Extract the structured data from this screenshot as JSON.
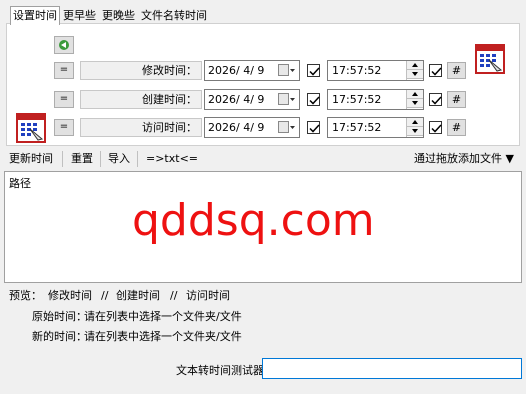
{
  "tabs": [
    {
      "label": "设置时间",
      "active": true
    },
    {
      "label": "更早些",
      "active": false
    },
    {
      "label": "更晚些",
      "active": false
    },
    {
      "label": "文件名转时间",
      "active": false
    }
  ],
  "rows": [
    {
      "equals_label": "=",
      "label": "修改时间：",
      "date": "2026/  4/  9",
      "checked": true,
      "time": "17:57:52",
      "time_checked": true,
      "hash_label": "#"
    },
    {
      "equals_label": "=",
      "label": "创建时间：",
      "date": "2026/  4/  9",
      "checked": true,
      "time": "17:57:52",
      "time_checked": true,
      "hash_label": "#"
    },
    {
      "equals_label": "=",
      "label": "访问时间：",
      "date": "2026/  4/  9",
      "checked": true,
      "time": "17:57:52",
      "time_checked": true,
      "hash_label": "#"
    }
  ],
  "toolbar": {
    "update": "更新时间",
    "reset": "重置",
    "import": "导入",
    "txt": "=>txt<=",
    "drag_add": "通过拖放添加文件 ▼"
  },
  "list": {
    "header": "路径",
    "watermark": "qddsq.com"
  },
  "preview": {
    "label": "预览：",
    "items": [
      "修改时间",
      "//",
      "创建时间",
      "//",
      "访问时间"
    ],
    "original_label": "原始时间：",
    "original_value": "请在列表中选择一个文件夹/文件",
    "new_label": "新的时间：",
    "new_value": "请在列表中选择一个文件夹/文件"
  },
  "tester": {
    "label": "文本转时间测试器",
    "value": ""
  },
  "colors": {
    "accent_green": "#2e8b2e",
    "watermark_red": "#ee1111"
  }
}
